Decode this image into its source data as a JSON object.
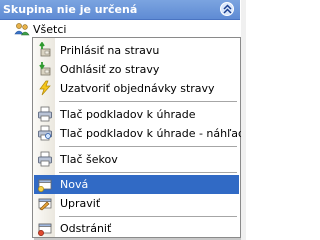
{
  "panel": {
    "title": "Skupina nie je určená",
    "tree_root_label": "Všetci"
  },
  "menu": {
    "items": [
      {
        "label": "Prihlásiť na stravu",
        "icon": "login-meal-icon"
      },
      {
        "label": "Odhlásiť zo stravy",
        "icon": "logout-meal-icon"
      },
      {
        "label": "Uzatvoriť objednávky stravy",
        "icon": "lightning-icon"
      },
      {
        "label": "Tlač podkladov k úhrade",
        "icon": "printer-icon"
      },
      {
        "label": "Tlač podkladov k úhrade - náhľad",
        "icon": "print-preview-icon"
      },
      {
        "label": "Tlač šekov",
        "icon": "printer-icon"
      },
      {
        "label": "Nová",
        "icon": "new-record-icon",
        "selected": true
      },
      {
        "label": "Upraviť",
        "icon": "edit-record-icon"
      },
      {
        "label": "Odstrániť",
        "icon": "delete-record-icon"
      }
    ]
  },
  "colors": {
    "titlebar": "#6a95da",
    "selection": "#316ac5",
    "menu_border": "#8a8a8a"
  }
}
